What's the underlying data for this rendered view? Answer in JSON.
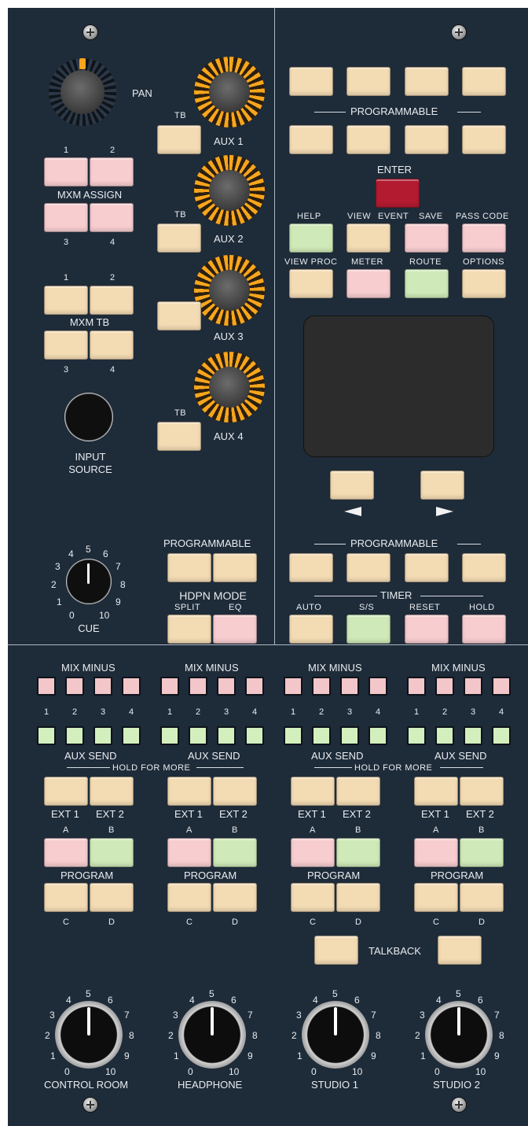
{
  "pan_label": "PAN",
  "tb": "TB",
  "aux": {
    "a1": "AUX 1",
    "a2": "AUX 2",
    "a3": "AUX 3",
    "a4": "AUX 4"
  },
  "mxm_assign": {
    "title": "MXM ASSIGN",
    "n1": "1",
    "n2": "2",
    "n3": "3",
    "n4": "4"
  },
  "mxm_tb": {
    "title": "MXM TB",
    "n1": "1",
    "n2": "2",
    "n3": "3",
    "n4": "4"
  },
  "input_source": "INPUT SOURCE",
  "cue": {
    "title": "CUE",
    "s0": "0",
    "s1": "1",
    "s2": "2",
    "s3": "3",
    "s4": "4",
    "s5": "5",
    "s6": "6",
    "s7": "7",
    "s8": "8",
    "s9": "9",
    "s10": "10"
  },
  "hdpn": {
    "programmable": "PROGRAMMABLE",
    "mode": "HDPN MODE",
    "split": "SPLIT",
    "eq": "EQ"
  },
  "right": {
    "programmable": "PROGRAMMABLE",
    "enter": "ENTER",
    "row1": {
      "help": "HELP",
      "view": "VIEW",
      "event": "EVENT",
      "save": "SAVE",
      "pass": "PASS CODE"
    },
    "row2": {
      "viewproc": "VIEW PROC",
      "meter": "METER",
      "route": "ROUTE",
      "options": "OPTIONS"
    },
    "timer": {
      "title": "TIMER",
      "auto": "AUTO",
      "ss": "S/S",
      "reset": "RESET",
      "hold": "HOLD"
    }
  },
  "bottom": {
    "mix_minus": "MIX MINUS",
    "aux_send": "AUX SEND",
    "hold_for_more": "HOLD FOR MORE",
    "n1": "1",
    "n2": "2",
    "n3": "3",
    "n4": "4",
    "ext1": "EXT 1",
    "ext2": "EXT 2",
    "a": "A",
    "b": "B",
    "c": "C",
    "d": "D",
    "program": "PROGRAM",
    "talkback": "TALKBACK",
    "knobs": {
      "k1": "CONTROL ROOM",
      "k2": "HEADPHONE",
      "k3": "STUDIO 1",
      "k4": "STUDIO 2"
    }
  },
  "colors": {
    "panel": "#1e2b39",
    "beige": "#f3dbb4",
    "pink": "#f7cdd0",
    "green": "#cfeab8",
    "enter": "#b31b30",
    "amber": "#f7a51c"
  }
}
